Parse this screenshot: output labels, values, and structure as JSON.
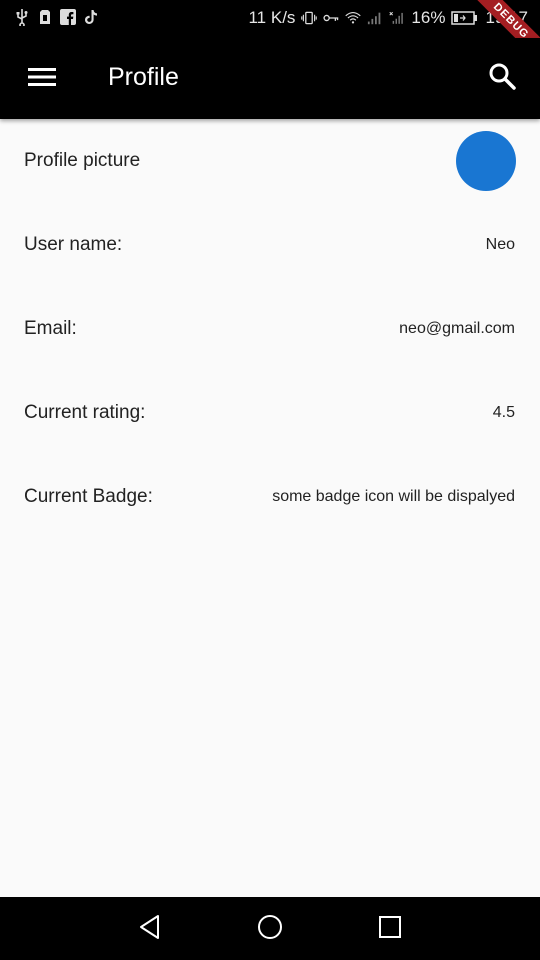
{
  "status_bar": {
    "network_speed": "11 K/s",
    "battery_percent": "16%",
    "time": "19:17",
    "debug_label": "DEBUG",
    "icons": [
      "usb-icon",
      "sim-icon",
      "facebook-icon",
      "tiktok-icon",
      "vibrate-icon",
      "vpn-key-icon",
      "wifi-icon",
      "signal-icon",
      "signal-x-icon",
      "battery-icon"
    ]
  },
  "app_bar": {
    "title": "Profile",
    "menu_icon": "menu-icon",
    "search_icon": "search-icon"
  },
  "profile": {
    "rows": [
      {
        "label": "Profile picture",
        "value": ""
      },
      {
        "label": "User name:",
        "value": "Neo"
      },
      {
        "label": "Email:",
        "value": "neo@gmail.com"
      },
      {
        "label": "Current rating:",
        "value": "4.5"
      },
      {
        "label": "Current Badge:",
        "value": "some badge icon will be dispalyed"
      }
    ],
    "avatar_color": "#1976d2"
  },
  "nav_bar": {
    "icons": [
      "back-icon",
      "home-icon",
      "recents-icon"
    ]
  },
  "colors": {
    "app_bar": "#000000",
    "background": "#fafafa",
    "accent": "#1976d2",
    "debug_banner": "#a41e22"
  }
}
